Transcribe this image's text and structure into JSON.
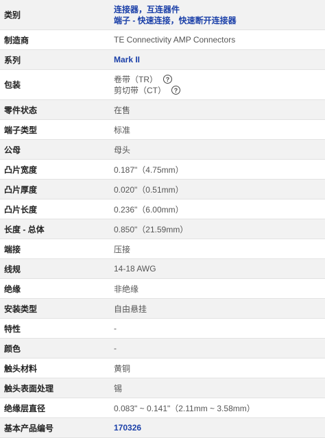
{
  "rows": {
    "category": {
      "label": "类别",
      "link1": "连接器，互连器件",
      "link2": "端子 - 快速连接，快速断开连接器"
    },
    "manufacturer": {
      "label": "制造商",
      "value": "TE Connectivity AMP Connectors"
    },
    "series": {
      "label": "系列",
      "value": "Mark II"
    },
    "packaging": {
      "label": "包装",
      "opt1": "卷带（TR）",
      "opt2": "剪切带（CT）",
      "help_icon": "question-circle"
    },
    "part_status": {
      "label": "零件状态",
      "value": "在售"
    },
    "terminal_type": {
      "label": "端子类型",
      "value": "标准"
    },
    "gender": {
      "label": "公母",
      "value": "母头"
    },
    "tab_width": {
      "label": "凸片宽度",
      "value": "0.187\"（4.75mm）"
    },
    "tab_thickness": {
      "label": "凸片厚度",
      "value": "0.020\"（0.51mm）"
    },
    "tab_length": {
      "label": "凸片长度",
      "value": "0.236\"（6.00mm）"
    },
    "overall_length": {
      "label": "长度 - 总体",
      "value": "0.850\"（21.59mm）"
    },
    "termination": {
      "label": "端接",
      "value": "压接"
    },
    "wire_gauge": {
      "label": "线规",
      "value": "14-18 AWG"
    },
    "insulation": {
      "label": "绝缘",
      "value": "非绝缘"
    },
    "mounting_type": {
      "label": "安装类型",
      "value": "自由悬挂"
    },
    "features": {
      "label": "特性",
      "value": "-"
    },
    "color": {
      "label": "颜色",
      "value": "-"
    },
    "contact_material": {
      "label": "触头材料",
      "value": "黄铜"
    },
    "contact_finish": {
      "label": "触头表面处理",
      "value": "锡"
    },
    "insulation_diameter": {
      "label": "绝缘层直径",
      "value": "0.083\" ~ 0.141\"（2.11mm ~ 3.58mm）"
    },
    "base_part_number": {
      "label": "基本产品编号",
      "value": "170326"
    }
  },
  "colors": {
    "link": "#1a3fa8",
    "row_alt": "#f2f2f2",
    "border": "#e2e2e2"
  }
}
